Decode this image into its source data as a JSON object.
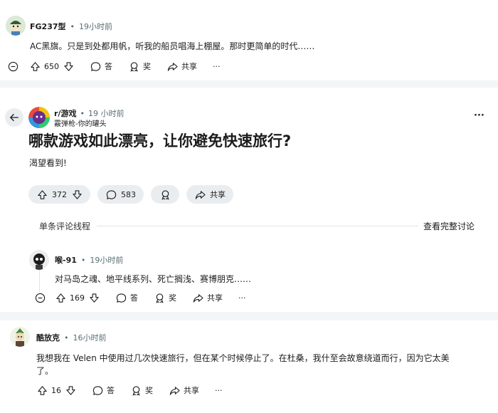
{
  "comment1": {
    "username": "FG237型",
    "time": "19小时前",
    "text": "AC黑旗。只是到处都用帆，听我的船员唱海上棚屋。那时更简单的时代……",
    "votes": "650",
    "reply_label": "答",
    "award_label": "奖",
    "share_label": "共享",
    "more_label": "···"
  },
  "post": {
    "subreddit": "r/游戏",
    "time": "19 小时前",
    "author_flair": "霰弹枪-你的罐头",
    "title": "哪款游戏如此漂亮，让你避免快速旅行?",
    "body": "渴望看到!",
    "votes": "372",
    "comments": "583",
    "share_label": "共享",
    "more_label": "···"
  },
  "thread_bar": {
    "single_label": "单条评论线程",
    "view_all_label": "查看完整讨论"
  },
  "comment2": {
    "username": "喉-91",
    "time": "19小时前",
    "text": "对马岛之魂、地平线系列、死亡搁浅、赛博朋克……",
    "votes": "169",
    "reply_label": "答",
    "award_label": "奖",
    "share_label": "共享",
    "more_label": "···"
  },
  "comment3": {
    "username": "酷放克",
    "time": "16小时前",
    "text_line1": "我想我在 Velen 中使用过几次快速旅行，但在某个时候停止了。在杜桑，我什至会故意绕道而行，因为它太美",
    "text_line2": "了。",
    "votes": "16",
    "reply_label": "答",
    "award_label": "奖",
    "share_label": "共享",
    "more_label": "···"
  },
  "colors": {
    "meta": "#576f76",
    "pill_bg": "#eaedef",
    "band_bg": "#f4f5f6"
  }
}
